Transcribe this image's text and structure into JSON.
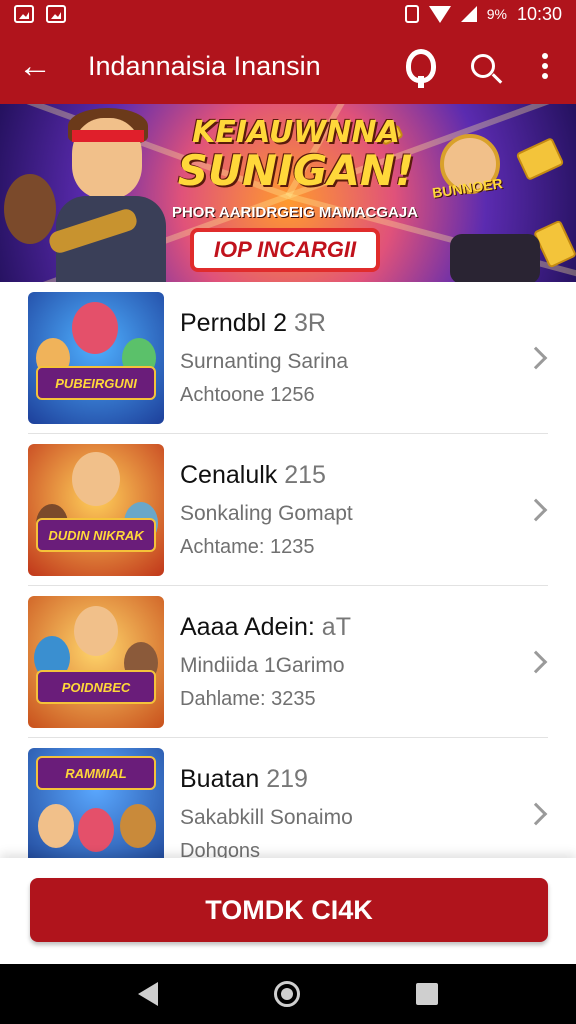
{
  "status_bar": {
    "icons": [
      "gallery-icon",
      "image-icon",
      "vibrate-icon",
      "wifi-icon",
      "signal-icon"
    ],
    "battery": "9%",
    "time": "10:30"
  },
  "app_bar": {
    "title": "Indannaisia Inansin",
    "icons": [
      "back-arrow-icon",
      "q-icon",
      "search-icon",
      "more-vert-icon"
    ]
  },
  "banner": {
    "headline_1": "KEIAUWNNA",
    "headline_2": "SUNIGAN!",
    "subtitle": "PHOR AARIDRGEIG MAMACGAJA",
    "cta": "IOP INCARGII",
    "side_logo": "BUNNOER"
  },
  "games": [
    {
      "title": "Perndbl 2",
      "suffix": "3R",
      "line2": "Surnanting Sarina",
      "line3": "Achtoone 1256",
      "thumb_logo": "PUBEIRGUNI",
      "accent": "#2d7bd8"
    },
    {
      "title": "Cenalulk",
      "suffix": "215",
      "line2": "Sonkaling Gomapt",
      "line3": "Achtame: 1235",
      "thumb_logo": "DUDIN NIKRAK",
      "accent": "#e07a1c"
    },
    {
      "title": "Aaaa Adein:",
      "suffix": "aT",
      "line2": "Mindiida 1Garimo",
      "line3": "Dahlame: 3235",
      "thumb_logo": "POIDNBEC",
      "accent": "#d6821a"
    },
    {
      "title": "Buatan",
      "suffix": "219",
      "line2": "Sakabkill Sonaimo",
      "line3": "Dohgons",
      "thumb_logo": "RAMMIAL",
      "accent": "#2a6ad0"
    }
  ],
  "bottom_action": {
    "label": "TOMDK CI4K"
  },
  "nav_bar": {
    "icons": [
      "nav-back-icon",
      "nav-home-icon",
      "nav-recent-icon"
    ]
  }
}
